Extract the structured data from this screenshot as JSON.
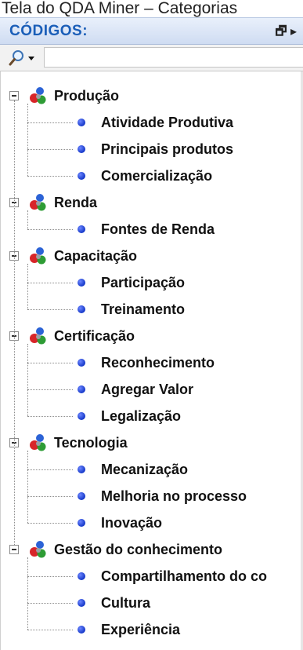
{
  "caption": "Tela do QDA Miner – Categorias",
  "panel": {
    "title": "CÓDIGOS:",
    "controls": "🗗 ▸",
    "search_placeholder": ""
  },
  "tree": [
    {
      "label": "Produção",
      "children": [
        "Atividade Produtiva",
        "Principais produtos",
        "Comercialização"
      ]
    },
    {
      "label": "Renda",
      "children": [
        "Fontes de Renda"
      ]
    },
    {
      "label": "Capacitação",
      "children": [
        "Participação",
        "Treinamento"
      ]
    },
    {
      "label": "Certificação",
      "children": [
        "Reconhecimento",
        "Agregar Valor",
        "Legalização"
      ]
    },
    {
      "label": "Tecnologia",
      "children": [
        "Mecanização",
        "Melhoria no processo",
        "Inovação"
      ]
    },
    {
      "label": "Gestão do conhecimento",
      "children": [
        "Compartilhamento do co",
        "Cultura",
        "Experiência"
      ]
    }
  ],
  "icons": {
    "category": "colored-spheres-icon",
    "code": "blue-dot-icon",
    "search": "magnifier-icon"
  },
  "colors": {
    "header_title": "#1a5eb8",
    "code_dot": "#1437c8"
  }
}
